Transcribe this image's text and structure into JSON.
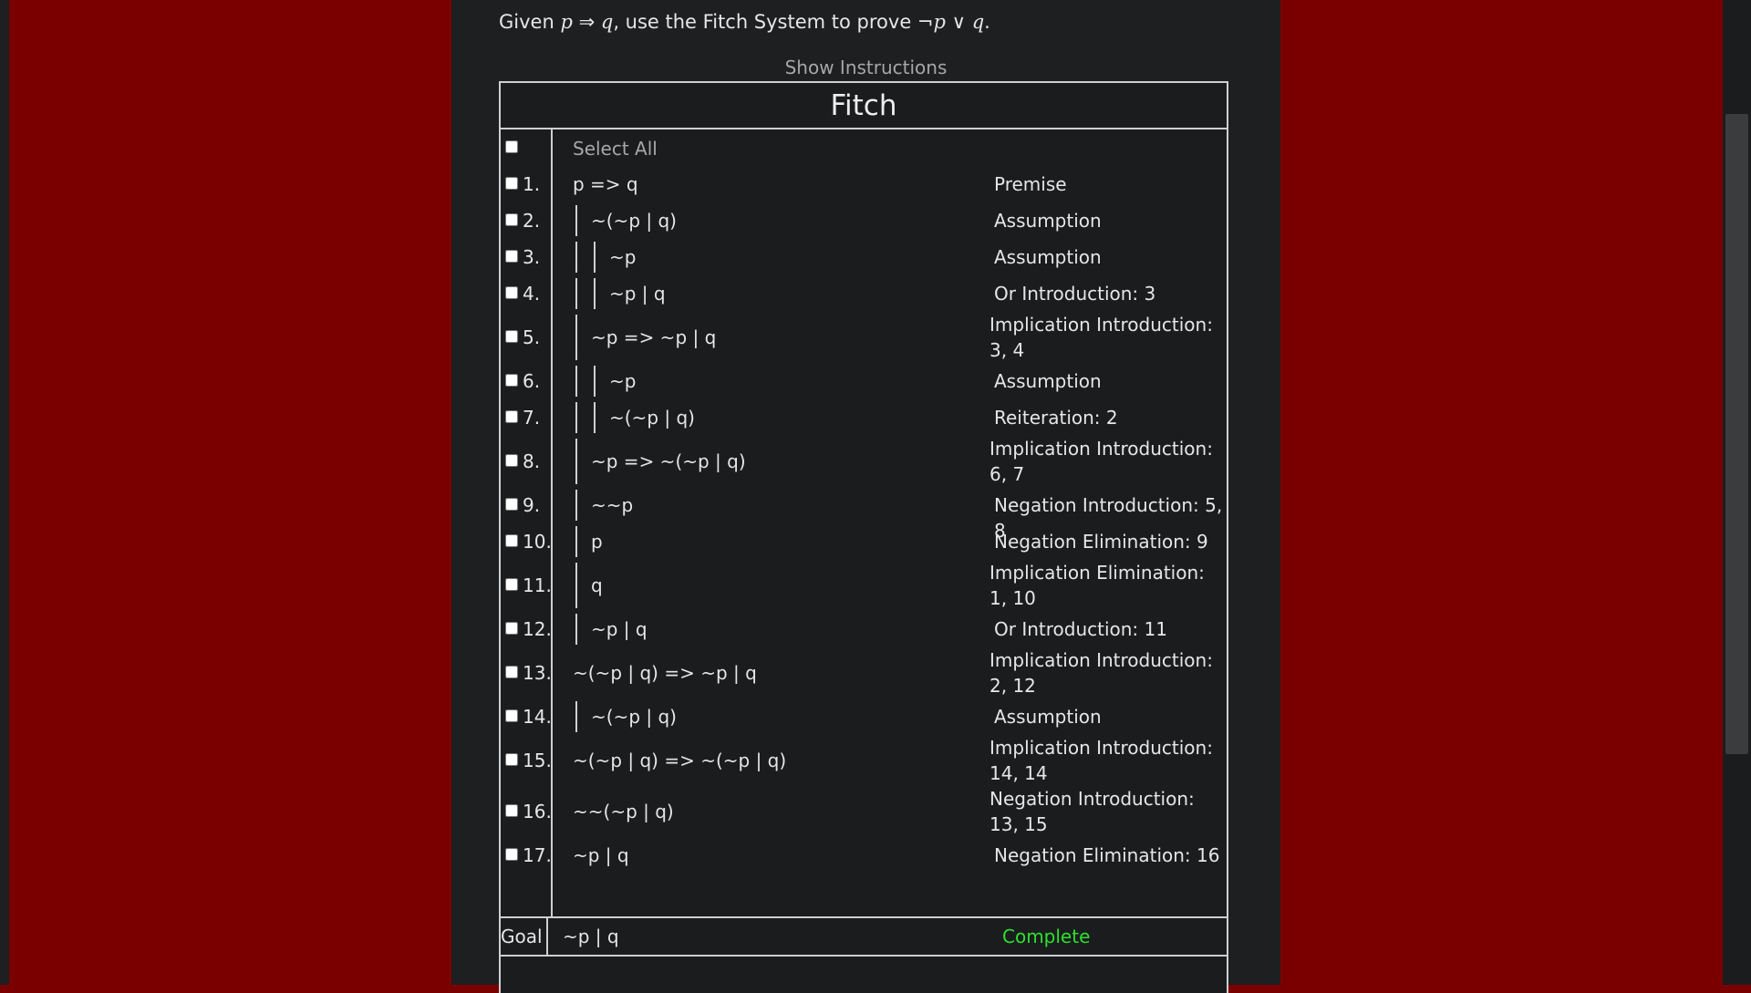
{
  "prompt": {
    "prefix": "Given ",
    "p": "p",
    "arrow": " ⇒ ",
    "q": "q",
    "middle": ", use the Fitch System to prove ",
    "not": "¬",
    "p2": "p",
    "or": " ∨ ",
    "q2": "q",
    "suffix": "."
  },
  "show_instructions": "Show Instructions",
  "fitch_title": "Fitch",
  "select_all": "Select All",
  "rows": [
    {
      "num": "1.",
      "formula": "p => q",
      "just": "Premise"
    },
    {
      "num": "2.",
      "formula": "~(~p | q)",
      "just": "Assumption"
    },
    {
      "num": "3.",
      "formula": "~p",
      "just": "Assumption"
    },
    {
      "num": "4.",
      "formula": "~p | q",
      "just": "Or Introduction: 3"
    },
    {
      "num": "5.",
      "formula": "~p => ~p | q",
      "just": "Implication Introduction: 3, 4"
    },
    {
      "num": "6.",
      "formula": "~p",
      "just": "Assumption"
    },
    {
      "num": "7.",
      "formula": "~(~p | q)",
      "just": "Reiteration: 2"
    },
    {
      "num": "8.",
      "formula": "~p => ~(~p | q)",
      "just": "Implication Introduction: 6, 7"
    },
    {
      "num": "9.",
      "formula": "~~p",
      "just": "Negation Introduction: 5, 8"
    },
    {
      "num": "10.",
      "formula": "p",
      "just": "Negation Elimination: 9"
    },
    {
      "num": "11.",
      "formula": "q",
      "just": "Implication Elimination: 1, 10"
    },
    {
      "num": "12.",
      "formula": "~p | q",
      "just": "Or Introduction: 11"
    },
    {
      "num": "13.",
      "formula": "~(~p | q) => ~p | q",
      "just": "Implication Introduction: 2, 12"
    },
    {
      "num": "14.",
      "formula": "~(~p | q)",
      "just": "Assumption"
    },
    {
      "num": "15.",
      "formula": "~(~p | q) => ~(~p | q)",
      "just": "Implication Introduction: 14, 14"
    },
    {
      "num": "16.",
      "formula": "~~(~p | q)",
      "just": "Negation Introduction: 13, 15"
    },
    {
      "num": "17.",
      "formula": "~p | q",
      "just": "Negation Elimination: 16"
    }
  ],
  "goal": {
    "label": "Goal",
    "formula": "~p | q",
    "status": "Complete"
  },
  "colors": {
    "page_background": "#7a0000",
    "panel": "#1e1f21",
    "status_complete": "#2ee02e"
  }
}
